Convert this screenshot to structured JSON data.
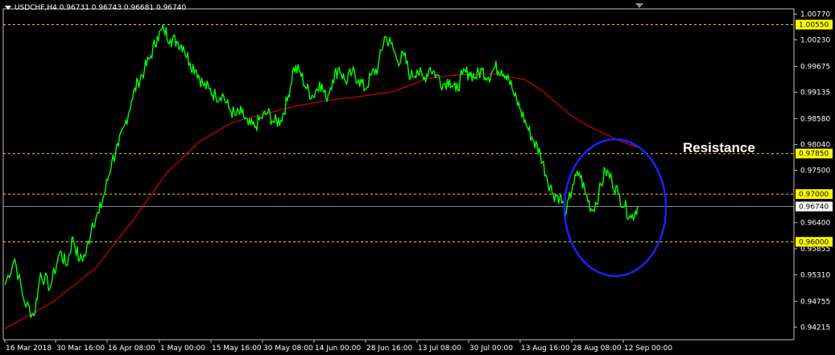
{
  "header": {
    "symbol": "USDCHF,H4",
    "open": "0.96731",
    "high": "0.96743",
    "low": "0.96681",
    "close": "0.96740"
  },
  "annotation": "Resistance",
  "chart_data": {
    "type": "line",
    "ylim": [
      0.9395,
      1.0088
    ],
    "y_ticks": [
      "1.00770",
      "1.00230",
      "0.99675",
      "0.99135",
      "0.98580",
      "0.98040",
      "0.97500",
      "0.96400",
      "0.95855",
      "0.95310",
      "0.94755",
      "0.94215"
    ],
    "x_ticks": [
      "16 Mar 2018",
      "30 Mar 16:00",
      "16 Apr 08:00",
      "1 May 00:00",
      "15 May 16:00",
      "30 May 08:00",
      "14 Jun 00:00",
      "28 Jun 16:00",
      "13 Jul 08:00",
      "30 Jul 00:00",
      "13 Aug 16:00",
      "28 Aug 08:00",
      "12 Sep 00:00"
    ],
    "levels": [
      {
        "label": "1.00550",
        "value": 1.0055
      },
      {
        "label": "0.97850",
        "value": 0.9785
      },
      {
        "label": "0.97000",
        "value": 0.97
      },
      {
        "label": "0.96000",
        "value": 0.96
      }
    ],
    "current_price": {
      "label": "0.96740",
      "value": 0.9674
    },
    "series": [
      {
        "color": "#00ff00",
        "points": [
          [
            0,
            0.951
          ],
          [
            3,
            0.9565
          ],
          [
            6,
            0.9475
          ],
          [
            9,
            0.9445
          ],
          [
            11,
            0.9535
          ],
          [
            14,
            0.9505
          ],
          [
            17,
            0.958
          ],
          [
            19,
            0.955
          ],
          [
            21,
            0.961
          ],
          [
            23,
            0.956
          ],
          [
            25,
            0.9575
          ],
          [
            27,
            0.964
          ],
          [
            29,
            0.966
          ],
          [
            31,
            0.971
          ],
          [
            33,
            0.977
          ],
          [
            35,
            0.98
          ],
          [
            37,
            0.9845
          ],
          [
            39,
            0.9895
          ],
          [
            41,
            0.9935
          ],
          [
            43,
            0.996
          ],
          [
            45,
            0.999
          ],
          [
            47,
            1.003
          ],
          [
            49,
            1.0045
          ],
          [
            51,
            1.0025
          ],
          [
            53,
            1.002
          ],
          [
            55,
            1.001
          ],
          [
            57,
            0.9975
          ],
          [
            59,
            0.996
          ],
          [
            61,
            0.993
          ],
          [
            63,
            0.992
          ],
          [
            65,
            0.9905
          ],
          [
            67,
            0.991
          ],
          [
            69,
            0.988
          ],
          [
            71,
            0.9865
          ],
          [
            73,
            0.987
          ],
          [
            75,
            0.9845
          ],
          [
            77,
            0.984
          ],
          [
            79,
            0.986
          ],
          [
            81,
            0.987
          ],
          [
            83,
            0.985
          ],
          [
            85,
            0.9855
          ],
          [
            87,
            0.9895
          ],
          [
            89,
            0.9965
          ],
          [
            91,
            0.9955
          ],
          [
            93,
            0.992
          ],
          [
            95,
            0.9905
          ],
          [
            97,
            0.9935
          ],
          [
            99,
            0.99
          ],
          [
            101,
            0.994
          ],
          [
            103,
            0.9965
          ],
          [
            105,
            0.9935
          ],
          [
            107,
            0.9955
          ],
          [
            109,
            0.994
          ],
          [
            111,
            0.992
          ],
          [
            113,
            0.995
          ],
          [
            115,
            0.9965
          ],
          [
            117,
            1.003
          ],
          [
            119,
            1.0015
          ],
          [
            121,
            0.998
          ],
          [
            123,
            0.999
          ],
          [
            125,
            0.9945
          ],
          [
            127,
            0.996
          ],
          [
            129,
            0.994
          ],
          [
            131,
            0.9965
          ],
          [
            133,
            0.995
          ],
          [
            135,
            0.993
          ],
          [
            137,
            0.994
          ],
          [
            139,
            0.9915
          ],
          [
            141,
            0.995
          ],
          [
            143,
            0.9955
          ],
          [
            145,
            0.9945
          ],
          [
            147,
            0.996
          ],
          [
            149,
            0.9945
          ],
          [
            151,
            0.9965
          ],
          [
            153,
            0.996
          ],
          [
            155,
            0.995
          ],
          [
            157,
            0.9905
          ],
          [
            159,
            0.9875
          ],
          [
            161,
            0.984
          ],
          [
            163,
            0.981
          ],
          [
            165,
            0.9785
          ],
          [
            167,
            0.9735
          ],
          [
            169,
            0.97
          ],
          [
            171,
            0.9695
          ],
          [
            173,
            0.966
          ],
          [
            175,
            0.972
          ],
          [
            177,
            0.9745
          ],
          [
            179,
            0.97
          ],
          [
            181,
            0.9665
          ],
          [
            183,
            0.97
          ],
          [
            185,
            0.975
          ],
          [
            187,
            0.973
          ],
          [
            189,
            0.97
          ],
          [
            191,
            0.9675
          ],
          [
            193,
            0.965
          ],
          [
            195,
            0.9674
          ]
        ]
      },
      {
        "color": "#ff0000",
        "points": [
          [
            0,
            0.9418
          ],
          [
            15,
            0.9475
          ],
          [
            28,
            0.9545
          ],
          [
            40,
            0.965
          ],
          [
            50,
            0.9745
          ],
          [
            60,
            0.981
          ],
          [
            70,
            0.985
          ],
          [
            80,
            0.9868
          ],
          [
            90,
            0.9885
          ],
          [
            100,
            0.9897
          ],
          [
            110,
            0.9905
          ],
          [
            120,
            0.9915
          ],
          [
            130,
            0.9942
          ],
          [
            140,
            0.995
          ],
          [
            150,
            0.9952
          ],
          [
            160,
            0.994
          ],
          [
            165,
            0.992
          ],
          [
            170,
            0.989
          ],
          [
            175,
            0.9862
          ],
          [
            180,
            0.9842
          ],
          [
            185,
            0.9826
          ],
          [
            190,
            0.981
          ],
          [
            195,
            0.9798
          ]
        ]
      }
    ]
  }
}
